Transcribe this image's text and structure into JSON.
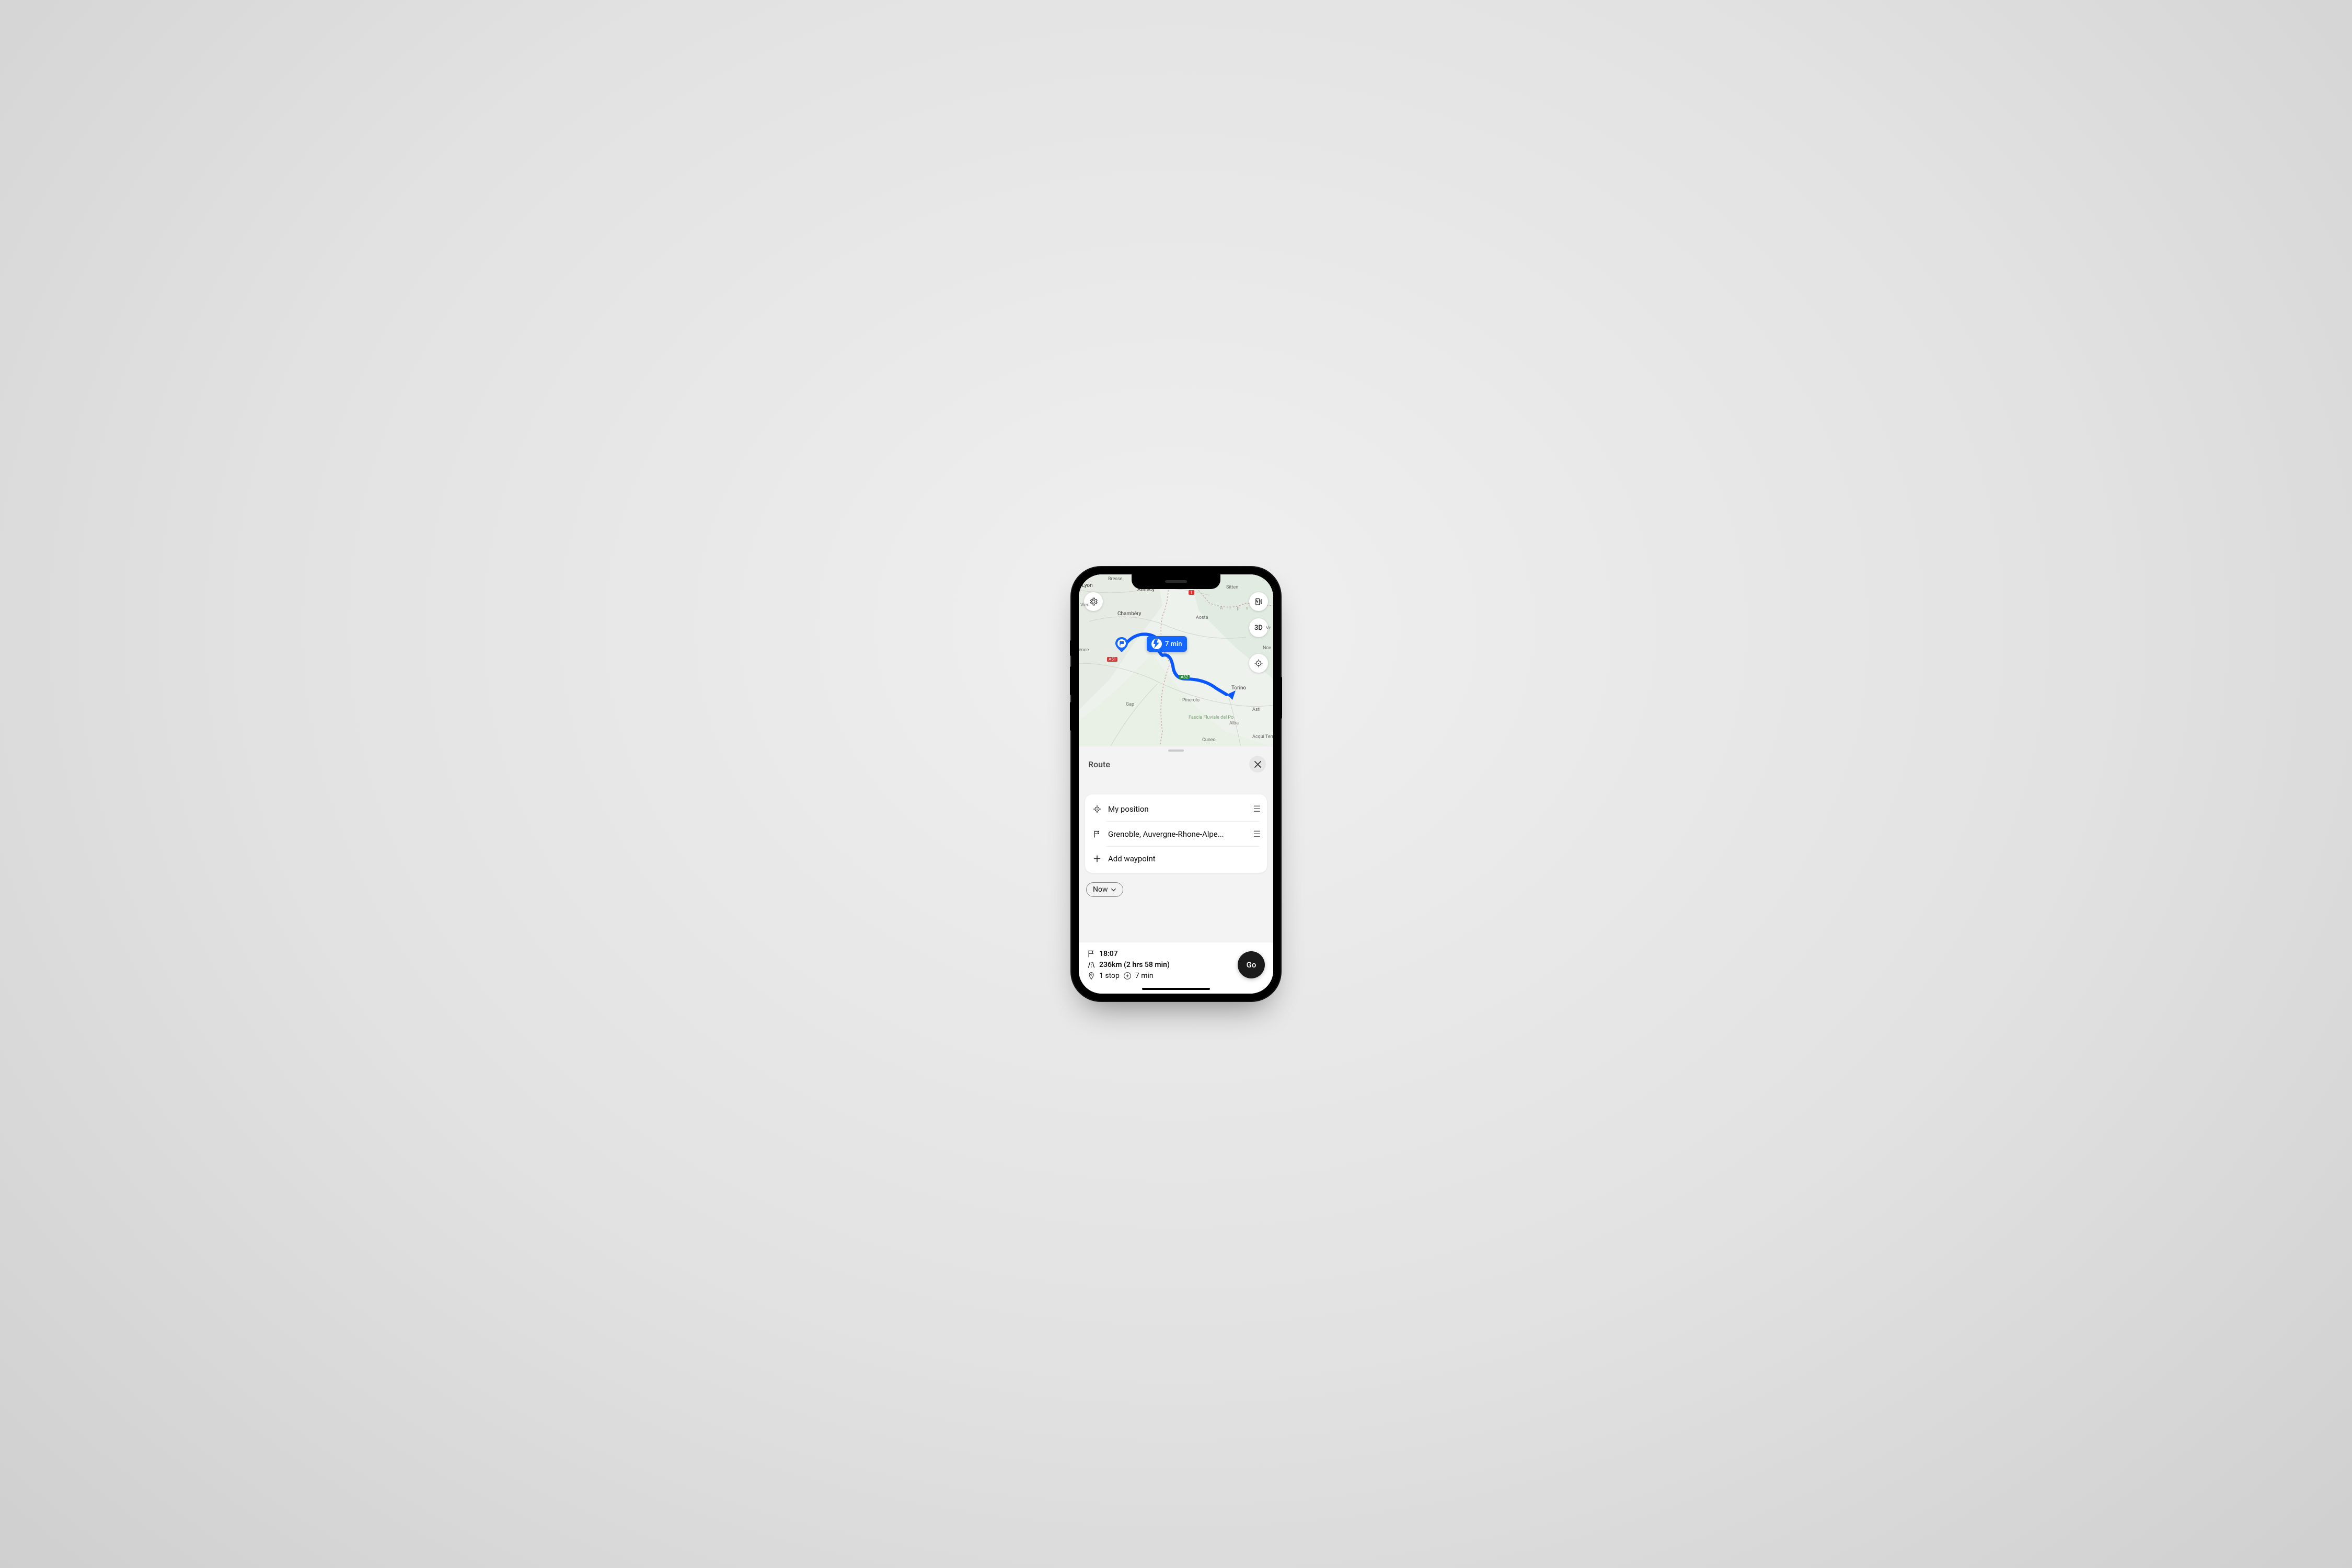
{
  "map": {
    "charge_tooltip": "7 min",
    "view_mode": "3D",
    "labels": {
      "lyon": "Lyon",
      "annecy": "Annecy",
      "sitten": "Sitten",
      "chambery": "Chambéry",
      "aosta": "Aosta",
      "vienne": "Vien",
      "valence": "ence",
      "gap": "Gap",
      "pinerolo": "Pinerolo",
      "torino": "Torino",
      "asti": "Asti",
      "alba": "Alba",
      "cuneo": "Cuneo",
      "novara": "Nov",
      "vercelli": "Ve",
      "acqui": "Acqui Terme",
      "fascia": "Fascia Fluviale del Po",
      "alps": "A l p s",
      "bresse": "Bresse"
    },
    "shields": {
      "a51": "A51",
      "a32": "A32",
      "r1": "1"
    }
  },
  "sheet": {
    "title": "Route",
    "waypoints": {
      "start": "My position",
      "dest": "Grenoble, Auvergne-Rhone-Alpe...",
      "add": "Add waypoint"
    },
    "time_chip": "Now"
  },
  "summary": {
    "arrival": "18:07",
    "distance_duration": "236km (2 hrs 58 min)",
    "stops": "1 stop",
    "charge_time": "7 min",
    "go": "Go"
  }
}
